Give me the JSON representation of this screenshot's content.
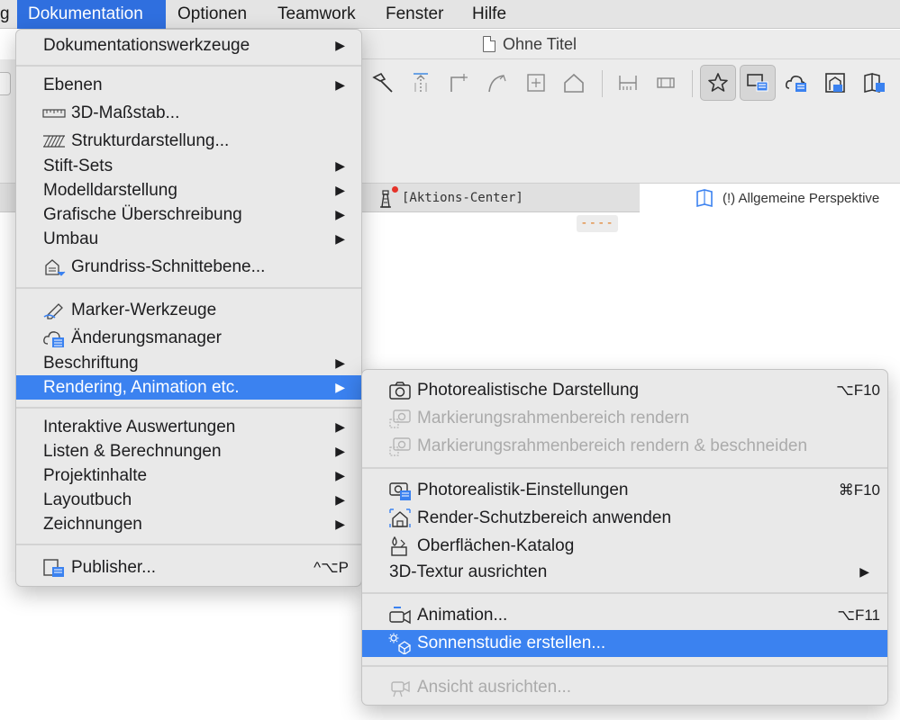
{
  "menubar": {
    "items": [
      {
        "label": "g"
      },
      {
        "label": "Dokumentation"
      },
      {
        "label": "Optionen"
      },
      {
        "label": "Teamwork"
      },
      {
        "label": "Fenster"
      },
      {
        "label": "Hilfe"
      }
    ]
  },
  "window": {
    "title": "Ohne Titel",
    "tabs": [
      {
        "label": "[Aktions-Center]"
      },
      {
        "label": "(!) Allgemeine Perspektive"
      }
    ],
    "dash_marker": "----"
  },
  "main_menu": {
    "items": [
      {
        "label": "Dokumentationswerkzeuge",
        "submenu": true
      },
      {
        "label": "Ebenen",
        "submenu": true
      },
      {
        "label": "3D-Maßstab...",
        "icon": "ruler-icon"
      },
      {
        "label": "Strukturdarstellung...",
        "icon": "hatch-icon"
      },
      {
        "label": "Stift-Sets",
        "submenu": true
      },
      {
        "label": "Modelldarstellung",
        "submenu": true
      },
      {
        "label": "Grafische Überschreibung",
        "submenu": true
      },
      {
        "label": "Umbau",
        "submenu": true
      },
      {
        "label": "Grundriss-Schnittebene...",
        "icon": "floorplan-cut-icon"
      },
      {
        "label": "Marker-Werkzeuge",
        "icon": "marker-icon"
      },
      {
        "label": "Änderungsmanager",
        "icon": "change-manager-icon"
      },
      {
        "label": "Beschriftung",
        "submenu": true
      },
      {
        "label": "Rendering, Animation etc.",
        "submenu": true,
        "highlighted": true
      },
      {
        "label": "Interaktive Auswertungen",
        "submenu": true
      },
      {
        "label": "Listen & Berechnungen",
        "submenu": true
      },
      {
        "label": "Projektinhalte",
        "submenu": true
      },
      {
        "label": "Layoutbuch",
        "submenu": true
      },
      {
        "label": "Zeichnungen",
        "submenu": true
      },
      {
        "label": "Publisher...",
        "icon": "publisher-icon",
        "shortcut": "^⌥P"
      }
    ],
    "arrow": "▶"
  },
  "sub_menu": {
    "items": [
      {
        "label": "Photorealistische Darstellung",
        "icon": "camera-icon",
        "shortcut": "⌥F10"
      },
      {
        "label": "Markierungsrahmenbereich rendern",
        "icon": "camera-marquee-icon",
        "disabled": true
      },
      {
        "label": "Markierungsrahmenbereich rendern & beschneiden",
        "icon": "camera-crop-icon",
        "disabled": true
      },
      {
        "label": "Photorealistik-Einstellungen",
        "icon": "camera-settings-icon",
        "shortcut": "⌘F10"
      },
      {
        "label": "Render-Schutzbereich anwenden",
        "icon": "safe-area-icon"
      },
      {
        "label": "Oberflächen-Katalog",
        "icon": "surface-catalog-icon"
      },
      {
        "label": "3D-Textur ausrichten",
        "submenu": true
      },
      {
        "label": "Animation...",
        "icon": "video-camera-icon",
        "shortcut": "⌥F11"
      },
      {
        "label": "Sonnenstudie erstellen...",
        "icon": "sun-study-icon",
        "highlighted": true
      },
      {
        "label": "Ansicht ausrichten...",
        "icon": "align-view-icon",
        "disabled": true
      }
    ],
    "arrow": "▶"
  },
  "colors": {
    "highlight": "#3b82f0",
    "menubar_active": "#2f6fdf",
    "disabled_text": "#ababab",
    "notification_dot": "#e5332a"
  }
}
